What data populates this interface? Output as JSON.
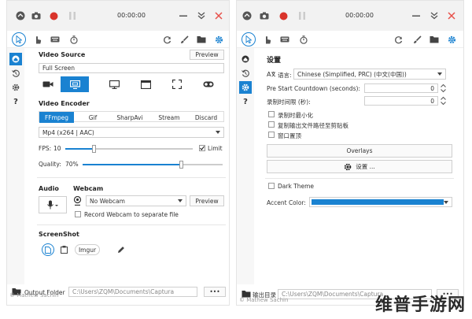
{
  "left": {
    "time": "00:00:00",
    "video_source": {
      "title": "Video Source",
      "preview_label": "Preview",
      "current": "Full Screen"
    },
    "video_encoder": {
      "title": "Video Encoder",
      "tabs": [
        "FFmpeg",
        "Gif",
        "SharpAvi",
        "Stream",
        "Discard"
      ],
      "active_tab": 0,
      "codec": "Mp4 (x264 | AAC)",
      "fps_label": "FPS:",
      "fps_value": "10",
      "fps_level": 0.22,
      "limit_label": "Limit",
      "quality_label": "Quality:",
      "quality_value": "70%",
      "quality_level": 0.7
    },
    "audio": {
      "title": "Audio"
    },
    "webcam": {
      "title": "Webcam",
      "current": "No Webcam",
      "preview_label": "Preview",
      "separate_label": "Record Webcam to separate file"
    },
    "screenshot": {
      "title": "ScreenShot",
      "imgur_label": "Imgur"
    },
    "output": {
      "label": "Output Folder",
      "path": "C:\\Users\\ZQM\\Documents\\Captura",
      "more": "•••"
    },
    "copyright": "© Mathew Sachin"
  },
  "right": {
    "time": "00:00:00",
    "settings_title": "设置",
    "language_label": "语言:",
    "language_value": "Chinese (Simplified, PRC) (中文(中国))",
    "pre_start_label": "Pre Start Countdown (seconds):",
    "pre_start_value": "0",
    "duration_label": "录制时间限 (秒):",
    "duration_value": "0",
    "minimize_label": "录制时最小化",
    "copy_path_label": "复制输出文件路径至剪贴板",
    "topmost_label": "窗口置顶",
    "overlays_label": "Overlays",
    "settings_btn_label": "设置 ...",
    "dark_theme_label": "Dark Theme",
    "accent_label": "Accent Color:",
    "output_label": "输出目录",
    "output_path": "C:\\Users\\ZQM\\Documents\\Captura",
    "more": "•••",
    "copyright": "© Mathew Sachin"
  },
  "colors": {
    "accent": "#1a82d1",
    "record": "#d9342b",
    "close": "#e8504a"
  },
  "watermark": "维普手游网"
}
